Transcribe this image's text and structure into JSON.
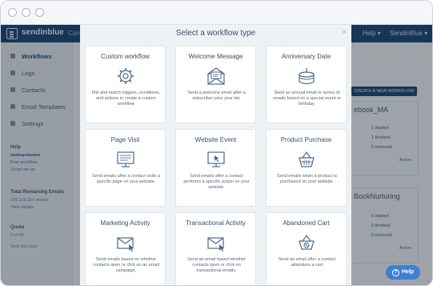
{
  "app": {
    "brand": "sendinblue",
    "nav_partial": "Cam",
    "help": "Help ▾",
    "account": "SendinBlue ▾"
  },
  "sidebar": {
    "items": [
      {
        "label": "Workflows",
        "active": true
      },
      {
        "label": "Logs"
      },
      {
        "label": "Contacts"
      },
      {
        "label": "Email Templates"
      },
      {
        "label": "Settings"
      }
    ],
    "help_heading": "Help",
    "help_links": [
      "Getting Started",
      "First workflow",
      "Script set up"
    ],
    "emails_heading": "Total Remaining Emails",
    "emails_value": "105,118,354 emails",
    "emails_link": "View details",
    "quota_heading": "Quota",
    "quota_value": "0 of 40",
    "quota_note": "Next this hour"
  },
  "main": {
    "create_button": "CREATE A NEW WORKFLOW",
    "cards": [
      {
        "title": "ebook_MA",
        "started": "1 started",
        "finished": "1 finished",
        "removed": "0 removed",
        "status": "Active"
      },
      {
        "title": "BookNurturing",
        "started": "0 started",
        "finished": "0 finished",
        "removed": "0 removed",
        "status": "Active"
      }
    ]
  },
  "modal": {
    "title": "Select a workflow type",
    "close": "×",
    "tiles": [
      {
        "title": "Custom workflow",
        "desc": "Mix and match triggers, conditions, and actions to create a custom workflow",
        "icon": "gear-icon"
      },
      {
        "title": "Welcome Message",
        "desc": "Send a welcome email after a subscriber joins your list.",
        "icon": "envelope-open-icon"
      },
      {
        "title": "Anniversary Date",
        "desc": "Send an annual email or series of emails based on a special event or birthday.",
        "icon": "cake-icon"
      },
      {
        "title": "Page Visit",
        "desc": "Send emails after a contact visits a specific page on your website.",
        "icon": "monitor-icon"
      },
      {
        "title": "Website Event",
        "desc": "Send emails after a contact performs a specific action on your website.",
        "icon": "cursor-window-icon"
      },
      {
        "title": "Product Purchase",
        "desc": "Send emails when a product is purchased on your website.",
        "icon": "basket-icon"
      },
      {
        "title": "Marketing Activity",
        "desc": "Send emails based on whether contacts open or click on an email campaign.",
        "icon": "email-activity-icon"
      },
      {
        "title": "Transactional Activity",
        "desc": "Send an email based whether contacts open or click on transactional emails.",
        "icon": "email-transaction-icon"
      },
      {
        "title": "Abandoned Cart",
        "desc": "Send an email after a contact abandons a cart",
        "icon": "cart-icon"
      }
    ]
  },
  "help_button": "Help",
  "colors": {
    "topbar": "#0a3a6b",
    "accent": "#3f7fcf"
  }
}
